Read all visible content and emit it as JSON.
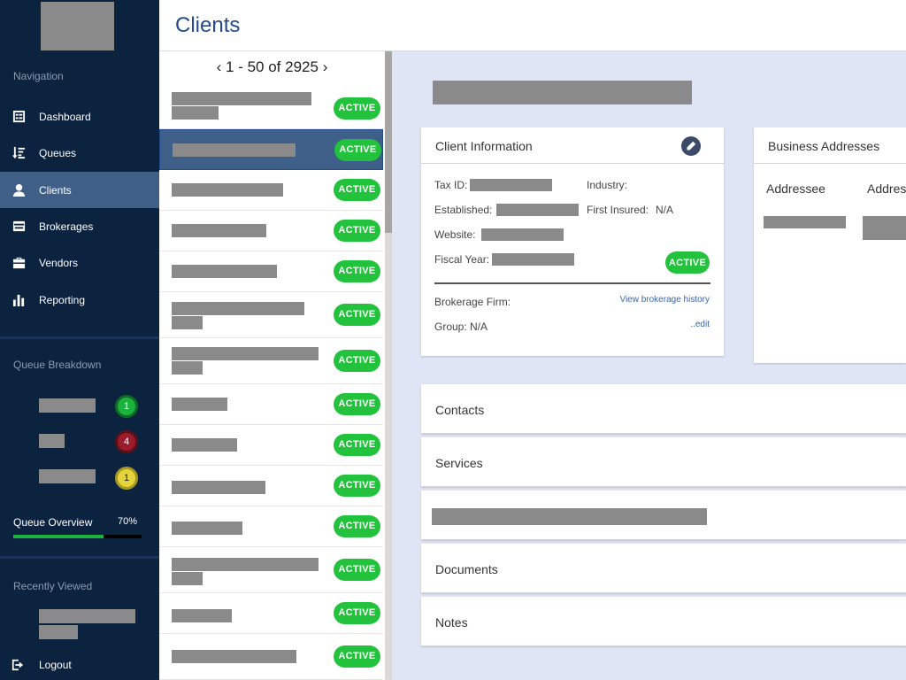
{
  "sidebar": {
    "nav_heading": "Navigation",
    "nav_items": [
      {
        "label": "Dashboard",
        "icon": "dashboard-icon"
      },
      {
        "label": "Queues",
        "icon": "queues-icon"
      },
      {
        "label": "Clients",
        "icon": "user-icon",
        "active": true
      },
      {
        "label": "Brokerages",
        "icon": "brokerage-icon"
      },
      {
        "label": "Vendors",
        "icon": "briefcase-icon"
      },
      {
        "label": "Reporting",
        "icon": "bar-chart-icon"
      }
    ],
    "queue_heading": "Queue Breakdown",
    "queue_counts": [
      "1",
      "4",
      "1"
    ],
    "queue_overview_label": "Queue Overview",
    "queue_overview_pct": "70%",
    "queue_overview_value": 0.7,
    "recent_heading": "Recently Viewed",
    "logout_label": "Logout"
  },
  "header": {
    "title": "Clients"
  },
  "list": {
    "prev": "‹",
    "range": "1 - 50 of 2925",
    "next": "›",
    "status_label": "ACTIVE"
  },
  "client_info": {
    "title": "Client Information",
    "tax_id_label": "Tax ID:",
    "industry_label": "Industry:",
    "established_label": "Established:",
    "first_insured_label": "First Insured:",
    "first_insured_value": "N/A",
    "website_label": "Website:",
    "fiscal_year_label": "Fiscal Year:",
    "status": "ACTIVE",
    "brokerage_label": "Brokerage Firm:",
    "brokerage_link": "View brokerage history",
    "group_label": "Group: N/A",
    "edit_link": "..edit"
  },
  "addresses": {
    "title": "Business Addresses",
    "col1": "Addressee",
    "col2": "Address"
  },
  "sections": [
    "Contacts",
    "Services",
    "Documents",
    "Notes"
  ],
  "colors": {
    "sidebar": "#0c2340",
    "accent": "#234a91",
    "active_green": "#23c23d",
    "content_bg": "#e0e5f5"
  }
}
